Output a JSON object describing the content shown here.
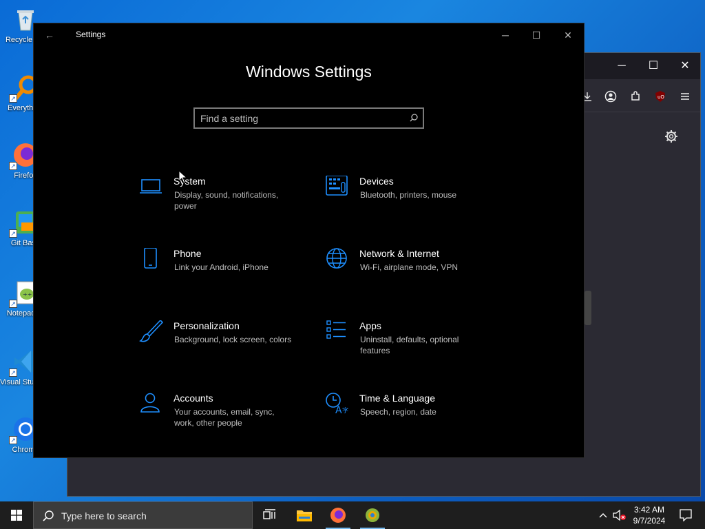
{
  "desktop": {
    "icons": [
      {
        "label": "Recycle Bin",
        "icon": "recycle-bin-icon"
      },
      {
        "label": "Everything",
        "icon": "everything-icon"
      },
      {
        "label": "Firefox",
        "icon": "firefox-icon"
      },
      {
        "label": "Git Bash",
        "icon": "git-bash-icon"
      },
      {
        "label": "Notepad++",
        "icon": "notepad-plus-plus-icon"
      },
      {
        "label": "Visual Studio Code",
        "icon": "vscode-icon"
      },
      {
        "label": "Chrome",
        "icon": "chrome-icon"
      }
    ]
  },
  "settings": {
    "window_title": "Settings",
    "heading": "Windows Settings",
    "search_placeholder": "Find a setting",
    "accent_color": "#1e8fff",
    "categories": [
      {
        "name": "System",
        "desc": "Display, sound, notifications, power",
        "icon": "laptop-icon"
      },
      {
        "name": "Devices",
        "desc": "Bluetooth, printers, mouse",
        "icon": "keyboard-icon"
      },
      {
        "name": "Phone",
        "desc": "Link your Android, iPhone",
        "icon": "phone-icon"
      },
      {
        "name": "Network & Internet",
        "desc": "Wi-Fi, airplane mode, VPN",
        "icon": "globe-icon"
      },
      {
        "name": "Personalization",
        "desc": "Background, lock screen, colors",
        "icon": "brush-icon"
      },
      {
        "name": "Apps",
        "desc": "Uninstall, defaults, optional features",
        "icon": "apps-list-icon"
      },
      {
        "name": "Accounts",
        "desc": "Your accounts, email, sync, work, other people",
        "icon": "person-icon"
      },
      {
        "name": "Time & Language",
        "desc": "Speech, region, date",
        "icon": "time-language-icon"
      }
    ]
  },
  "taskbar": {
    "search_placeholder": "Type here to search",
    "time": "3:42 AM",
    "date": "9/7/2024"
  }
}
